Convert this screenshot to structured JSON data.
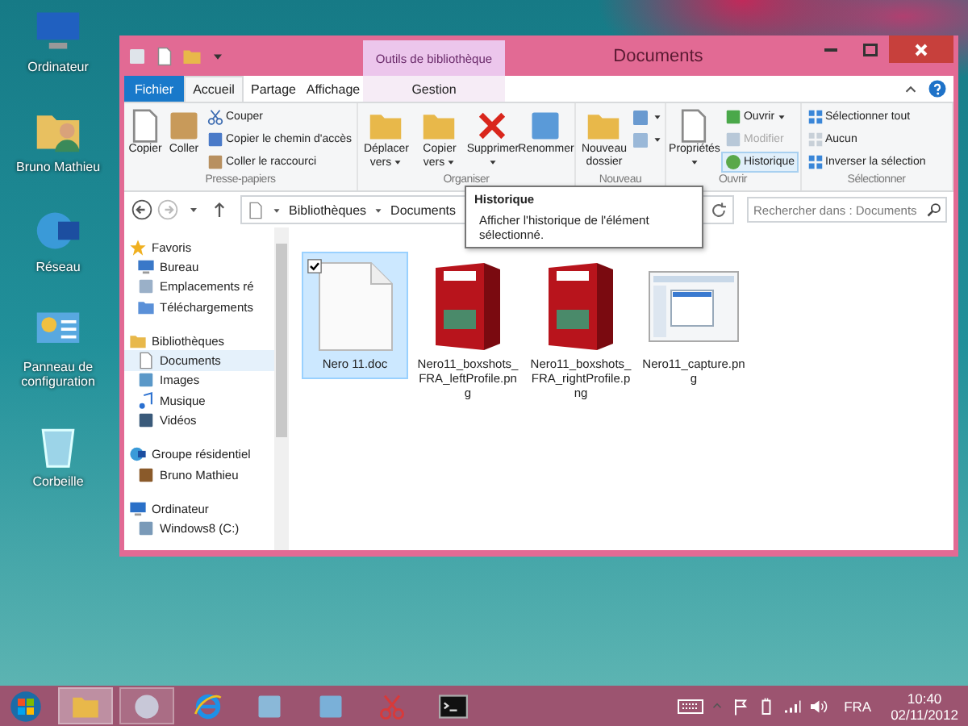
{
  "desktop_icons": [
    {
      "label": "Ordinateur"
    },
    {
      "label": "Bruno Mathieu"
    },
    {
      "label": "Réseau"
    },
    {
      "label": "Panneau de configuration"
    },
    {
      "label": "Corbeille"
    }
  ],
  "window": {
    "title": "Documents",
    "contextual_header": "Outils de bibliothèque",
    "tabs": [
      {
        "label": "Fichier",
        "kind": "file",
        "selected": false
      },
      {
        "label": "Accueil",
        "kind": "normal",
        "selected": true
      },
      {
        "label": "Partage",
        "kind": "normal",
        "selected": false
      },
      {
        "label": "Affichage",
        "kind": "normal",
        "selected": false
      },
      {
        "label": "Gestion",
        "kind": "contextual",
        "selected": false
      }
    ],
    "ribbon_groups": [
      {
        "name": "Presse-papiers",
        "items": [
          {
            "kind": "large",
            "label": "Copier",
            "dropdown": false
          },
          {
            "kind": "large",
            "label": "Coller",
            "dropdown": false
          },
          {
            "kind": "small",
            "label": "Couper",
            "disabled": false,
            "selected": false,
            "dropdown": false
          },
          {
            "kind": "small",
            "label": "Copier le chemin d'accès",
            "disabled": false,
            "selected": false,
            "dropdown": false
          },
          {
            "kind": "small",
            "label": "Coller le raccourci",
            "disabled": false,
            "selected": false,
            "dropdown": false
          }
        ]
      },
      {
        "name": "Organiser",
        "items": [
          {
            "kind": "large",
            "label": "Déplacer vers",
            "dropdown": true
          },
          {
            "kind": "large",
            "label": "Copier vers",
            "dropdown": true
          },
          {
            "kind": "large",
            "label": "Supprimer",
            "dropdown": true
          },
          {
            "kind": "large",
            "label": "Renommer",
            "dropdown": false
          }
        ]
      },
      {
        "name": "Nouveau",
        "items": [
          {
            "kind": "large",
            "label": "Nouveau dossier",
            "dropdown": false
          },
          {
            "kind": "icon",
            "dropdown": true
          },
          {
            "kind": "icon",
            "dropdown": true
          }
        ]
      },
      {
        "name": "Ouvrir",
        "items": [
          {
            "kind": "large",
            "label": "Propriétés",
            "dropdown": true
          },
          {
            "kind": "small",
            "label": "Ouvrir",
            "disabled": false,
            "selected": false,
            "dropdown": true
          },
          {
            "kind": "small",
            "label": "Modifier",
            "disabled": true,
            "selected": false,
            "dropdown": false
          },
          {
            "kind": "small",
            "label": "Historique",
            "disabled": false,
            "selected": true,
            "dropdown": false
          }
        ]
      },
      {
        "name": "Sélectionner",
        "items": [
          {
            "kind": "small",
            "label": "Sélectionner tout",
            "disabled": false,
            "selected": false,
            "dropdown": false
          },
          {
            "kind": "small",
            "label": "Aucun",
            "disabled": false,
            "selected": false,
            "dropdown": false
          },
          {
            "kind": "small",
            "label": "Inverser la sélection",
            "disabled": false,
            "selected": false,
            "dropdown": false
          }
        ]
      }
    ],
    "address": {
      "path": [
        "Bibliothèques",
        "Documents"
      ]
    },
    "search": {
      "placeholder": "Rechercher dans : Documents"
    },
    "tooltip": {
      "title": "Historique",
      "text": "Afficher l'historique de l'élément sélectionné."
    },
    "navigation": [
      {
        "label": "Favoris",
        "children": [
          {
            "label": "Bureau",
            "selected": false
          },
          {
            "label": "Emplacements ré",
            "selected": false
          },
          {
            "label": "Téléchargements",
            "selected": false
          }
        ]
      },
      {
        "label": "Bibliothèques",
        "children": [
          {
            "label": "Documents",
            "selected": true
          },
          {
            "label": "Images",
            "selected": false
          },
          {
            "label": "Musique",
            "selected": false
          },
          {
            "label": "Vidéos",
            "selected": false
          }
        ]
      },
      {
        "label": "Groupe résidentiel",
        "children": [
          {
            "label": "Bruno Mathieu",
            "selected": false
          }
        ]
      },
      {
        "label": "Ordinateur",
        "children": [
          {
            "label": "Windows8 (C:)",
            "selected": false
          }
        ]
      }
    ],
    "files": [
      {
        "name": "Nero 11.doc",
        "kind": "document",
        "selected": true,
        "checked": true
      },
      {
        "name": "Nero11_boxshots_FRA_leftProfile.png",
        "kind": "boxshot",
        "selected": false,
        "checked": false
      },
      {
        "name": "Nero11_boxshots_FRA_rightProfile.png",
        "kind": "boxshot",
        "selected": false,
        "checked": false
      },
      {
        "name": "Nero11_capture.png",
        "kind": "screenshot",
        "selected": false,
        "checked": false
      }
    ]
  },
  "taskbar": {
    "apps": [
      {
        "selected": true,
        "running": true
      },
      {
        "selected": false,
        "running": true
      },
      {
        "selected": false,
        "running": false
      },
      {
        "selected": false,
        "running": false
      },
      {
        "selected": false,
        "running": false
      },
      {
        "selected": false,
        "running": false
      },
      {
        "selected": false,
        "running": false
      }
    ],
    "language": "FRA",
    "time": "10:40",
    "date": "02/11/2012"
  }
}
